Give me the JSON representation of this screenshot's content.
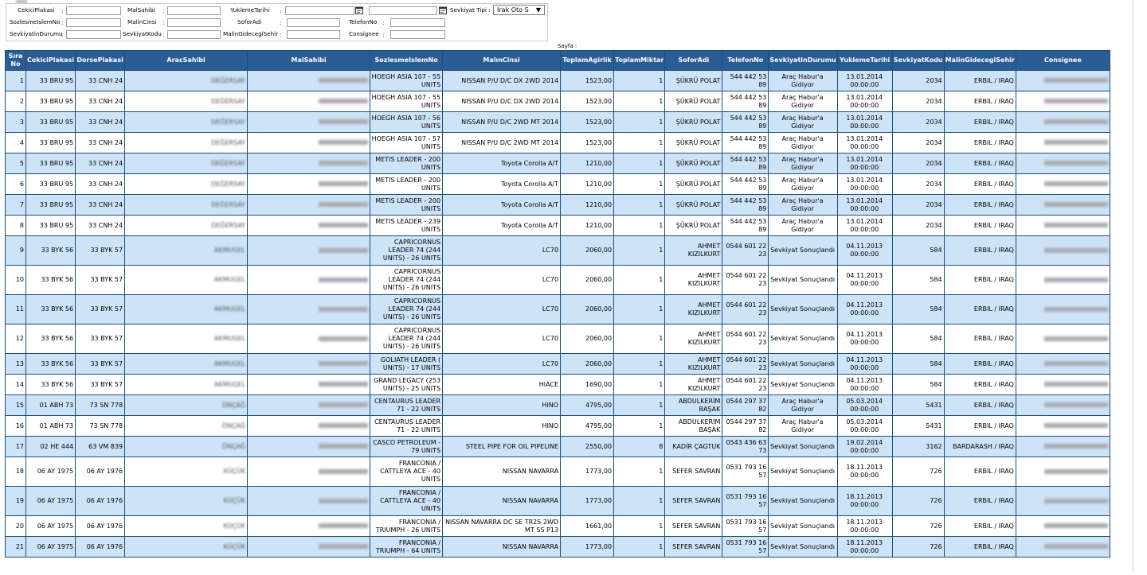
{
  "filters": {
    "cekici_label": "CekiciPlakasi",
    "malsahibi_label": "MalSahibi",
    "yukleme_label": "YuklemeTarihi",
    "sevkiyat_tipi_label": "Sevkiyat Tipi :",
    "sevkiyat_tipi_value": "Irak Oto S",
    "sozlesme_label": "SozlesmeIslemNo",
    "malincinsi_label": "MalinCinsi",
    "soforadi_label": "SoforAdi",
    "telefon_label": "TelefonNo",
    "sevkiyat_durumu_label": "SevkiyatinDurumu",
    "sevkiyat_kodu_label": "SevkiyatKodu",
    "malin_gidecegi_label": "MalinGidecegiSehir",
    "consignee_label": "Consignee",
    "colon": ":"
  },
  "sayfa_label": "Sayfa :",
  "table": {
    "headers": [
      "Sıra No",
      "CekiciPlakasi",
      "DorsePlakasi",
      "AracSahibi",
      "MalSahibi",
      "SozlesmeIslemNo",
      "MalınCinsi",
      "ToplamAgirlik",
      "ToplamMiktar",
      "SoforAdi",
      "TelefonNo",
      "SevkiyatinDurumu",
      "YuklemeTarihi",
      "SevkiyatKodu",
      "MalinGidecegiSehir",
      "Consignee"
    ],
    "rows": [
      {
        "no": "1",
        "cekici": "33 BRU 95",
        "dorse": "33 CNH 24",
        "arac": "DEĞERSAY",
        "sozlesme": "HOEGH ASIA 107 - 55 UNITS",
        "malin": "NISSAN P/U D/C DX 2WD 2014",
        "agirlik": "1523,00",
        "miktar": "1",
        "sofor": "ŞÜKRÜ POLAT",
        "tel": "544 442 53 89",
        "durum": "Araç Habur'a Gidiyor",
        "tarih": "13.01.2014 00:00:00",
        "kod": "2034",
        "sehir": "ERBIL / IRAQ"
      },
      {
        "no": "2",
        "cekici": "33 BRU 95",
        "dorse": "33 CNH 24",
        "arac": "DEĞERSAY",
        "sozlesme": "HOEGH ASIA 107 - 55 UNITS",
        "malin": "NISSAN P/U D/C DX 2WD 2014",
        "agirlik": "1523,00",
        "miktar": "1",
        "sofor": "ŞÜKRÜ POLAT",
        "tel": "544 442 53 89",
        "durum": "Araç Habur'a Gidiyor",
        "tarih": "13.01.2014 00:00:00",
        "kod": "2034",
        "sehir": "ERBIL / IRAQ"
      },
      {
        "no": "3",
        "cekici": "33 BRU 95",
        "dorse": "33 CNH 24",
        "arac": "DEĞERSAY",
        "sozlesme": "HOEGH ASIA 107 - 56 UNITS",
        "malin": "NISSAN P/U D/C 2WD MT 2014",
        "agirlik": "1523,00",
        "miktar": "1",
        "sofor": "ŞÜKRÜ POLAT",
        "tel": "544 442 53 89",
        "durum": "Araç Habur'a Gidiyor",
        "tarih": "13.01.2014 00:00:00",
        "kod": "2034",
        "sehir": "ERBIL / IRAQ"
      },
      {
        "no": "4",
        "cekici": "33 BRU 95",
        "dorse": "33 CNH 24",
        "arac": "DEĞERSAY",
        "sozlesme": "HOEGH ASIA 107 - 57 UNITS",
        "malin": "NISSAN P/U D/C 2WD MT 2014",
        "agirlik": "1523,00",
        "miktar": "1",
        "sofor": "ŞÜKRÜ POLAT",
        "tel": "544 442 53 89",
        "durum": "Araç Habur'a Gidiyor",
        "tarih": "13.01.2014 00:00:00",
        "kod": "2034",
        "sehir": "ERBIL / IRAQ"
      },
      {
        "no": "5",
        "cekici": "33 BRU 95",
        "dorse": "33 CNH 24",
        "arac": "DEĞERSAY",
        "sozlesme": "METIS LEADER - 200 UNITS",
        "malin": "Toyota Corolla A/T",
        "agirlik": "1210,00",
        "miktar": "1",
        "sofor": "ŞÜKRÜ POLAT",
        "tel": "544 442 53 89",
        "durum": "Araç Habur'a Gidiyor",
        "tarih": "13.01.2014 00:00:00",
        "kod": "2034",
        "sehir": "ERBIL / IRAQ"
      },
      {
        "no": "6",
        "cekici": "33 BRU 95",
        "dorse": "33 CNH 24",
        "arac": "DEĞERSAY",
        "sozlesme": "METIS LEADER - 200 UNITS",
        "malin": "Toyota Corolla A/T",
        "agirlik": "1210,00",
        "miktar": "1",
        "sofor": "ŞÜKRÜ POLAT",
        "tel": "544 442 53 89",
        "durum": "Araç Habur'a Gidiyor",
        "tarih": "13.01.2014 00:00:00",
        "kod": "2034",
        "sehir": "ERBIL / IRAQ"
      },
      {
        "no": "7",
        "cekici": "33 BRU 95",
        "dorse": "33 CNH 24",
        "arac": "DEĞERSAY",
        "sozlesme": "METIS LEADER - 200 UNITS",
        "malin": "Toyota Corolla A/T",
        "agirlik": "1210,00",
        "miktar": "1",
        "sofor": "ŞÜKRÜ POLAT",
        "tel": "544 442 53 89",
        "durum": "Araç Habur'a Gidiyor",
        "tarih": "13.01.2014 00:00:00",
        "kod": "2034",
        "sehir": "ERBIL / IRAQ"
      },
      {
        "no": "8",
        "cekici": "33 BRU 95",
        "dorse": "33 CNH 24",
        "arac": "DEĞERSAY",
        "sozlesme": "METIS LEADER - 239 UNITS",
        "malin": "Toyota Corolla A/T",
        "agirlik": "1210,00",
        "miktar": "1",
        "sofor": "ŞÜKRÜ POLAT",
        "tel": "544 442 53 89",
        "durum": "Araç Habur'a Gidiyor",
        "tarih": "13.01.2014 00:00:00",
        "kod": "2034",
        "sehir": "ERBIL / IRAQ"
      },
      {
        "no": "9",
        "cekici": "33 BYK 56",
        "dorse": "33 BYK 57",
        "arac": "AKMUGEL",
        "sozlesme": "CAPRICORNUS LEADER 74 (244 UNITS) - 26 UNITS",
        "malin": "LC70",
        "agirlik": "2060,00",
        "miktar": "1",
        "sofor": "AHMET KIZILKURT",
        "tel": "0544 601 22 23",
        "durum": "Sevkiyat Sonuçlandı",
        "tarih": "04.11.2013 00:00:00",
        "kod": "584",
        "sehir": "ERBIL / IRAQ"
      },
      {
        "no": "10",
        "cekici": "33 BYK 56",
        "dorse": "33 BYK 57",
        "arac": "AKMUGEL",
        "sozlesme": "CAPRICORNUS LEADER 74 (244 UNITS) - 26 UNITS",
        "malin": "LC70",
        "agirlik": "2060,00",
        "miktar": "1",
        "sofor": "AHMET KIZILKURT",
        "tel": "0544 601 22 23",
        "durum": "Sevkiyat Sonuçlandı",
        "tarih": "04.11.2013 00:00:00",
        "kod": "584",
        "sehir": "ERBIL / IRAQ"
      },
      {
        "no": "11",
        "cekici": "33 BYK 56",
        "dorse": "33 BYK 57",
        "arac": "AKMUGEL",
        "sozlesme": "CAPRICORNUS LEADER 74 (244 UNITS) - 26 UNITS",
        "malin": "LC70",
        "agirlik": "2060,00",
        "miktar": "1",
        "sofor": "AHMET KIZILKURT",
        "tel": "0544 601 22 23",
        "durum": "Sevkiyat Sonuçlandı",
        "tarih": "04.11.2013 00:00:00",
        "kod": "584",
        "sehir": "ERBIL / IRAQ"
      },
      {
        "no": "12",
        "cekici": "33 BYK 56",
        "dorse": "33 BYK 57",
        "arac": "AKMUGEL",
        "sozlesme": "CAPRICORNUS LEADER 74 (244 UNITS) - 26 UNITS",
        "malin": "LC70",
        "agirlik": "2060,00",
        "miktar": "1",
        "sofor": "AHMET KIZILKURT",
        "tel": "0544 601 22 23",
        "durum": "Sevkiyat Sonuçlandı",
        "tarih": "04.11.2013 00:00:00",
        "kod": "584",
        "sehir": "ERBIL / IRAQ"
      },
      {
        "no": "13",
        "cekici": "33 BYK 56",
        "dorse": "33 BYK 57",
        "arac": "AKMUGEL",
        "sozlesme": "GOLIATH LEADER ( UNITS) - 17 UNITS",
        "malin": "LC70",
        "agirlik": "2060,00",
        "miktar": "1",
        "sofor": "AHMET KIZILKURT",
        "tel": "0544 601 22 23",
        "durum": "Sevkiyat Sonuçlandı",
        "tarih": "04.11.2013 00:00:00",
        "kod": "584",
        "sehir": "ERBIL / IRAQ"
      },
      {
        "no": "14",
        "cekici": "33 BYK 56",
        "dorse": "33 BYK 57",
        "arac": "AKMUGEL",
        "sozlesme": "GRAND LEGACY (253 UNITS) - 25 UNITS",
        "malin": "HIACE",
        "agirlik": "1690,00",
        "miktar": "1",
        "sofor": "AHMET KIZILKURT",
        "tel": "0544 601 22 23",
        "durum": "Sevkiyat Sonuçlandı",
        "tarih": "04.11.2013 00:00:00",
        "kod": "584",
        "sehir": "ERBIL / IRAQ"
      },
      {
        "no": "15",
        "cekici": "01 ABH 73",
        "dorse": "73 SN 778",
        "arac": "ÖNÇAĞ",
        "sozlesme": "CENTAURUS LEADER 71 - 22 UNITS",
        "malin": "HINO",
        "agirlik": "4795,00",
        "miktar": "1",
        "sofor": "ABDULKERİM BAŞAK",
        "tel": "0544 297 37 82",
        "durum": "Araç Habur'a Gidiyor",
        "tarih": "05.03.2014 00:00:00",
        "kod": "5431",
        "sehir": "ERBIL / IRAQ"
      },
      {
        "no": "16",
        "cekici": "01 ABH 73",
        "dorse": "73 SN 778",
        "arac": "ÖNÇAĞ",
        "sozlesme": "CENTAURUS LEADER 71 - 22 UNITS",
        "malin": "HINO",
        "agirlik": "4795,00",
        "miktar": "1",
        "sofor": "ABDULKERİM BAŞAK",
        "tel": "0544 297 37 82",
        "durum": "Araç Habur'a Gidiyor",
        "tarih": "05.03.2014 00:00:00",
        "kod": "5431",
        "sehir": "ERBIL / IRAQ"
      },
      {
        "no": "17",
        "cekici": "02 HE 444",
        "dorse": "63 VM 839",
        "arac": "ÖNÇAĞ",
        "sozlesme": "CASCO PETROLEUM - 79 UNITS",
        "malin": "STEEL PIPE FOR OIL PIPELINE",
        "agirlik": "2550,00",
        "miktar": "8",
        "sofor": "KADİR ÇAGTUK",
        "tel": "0543 436 63 73",
        "durum": "Sevkiyat Sonuçlandı",
        "tarih": "19.02.2014 00:00:00",
        "kod": "3162",
        "sehir": "BARDARASH / IRAQ"
      },
      {
        "no": "18",
        "cekici": "06 AY 1975",
        "dorse": "06 AY 1976",
        "arac": "KÜÇÜK",
        "sozlesme": "FRANCONIA / CATTLEYA ACE - 40 UNITS",
        "malin": "NISSAN NAVARRA",
        "agirlik": "1773,00",
        "miktar": "1",
        "sofor": "SEFER SAVRAN",
        "tel": "0531 793 16 57",
        "durum": "Sevkiyat Sonuçlandı",
        "tarih": "18.11.2013 00:00:00",
        "kod": "726",
        "sehir": "ERBIL / IRAQ"
      },
      {
        "no": "19",
        "cekici": "06 AY 1975",
        "dorse": "06 AY 1976",
        "arac": "KÜÇÜK",
        "sozlesme": "FRANCONIA / CATTLEYA ACE - 40 UNITS",
        "malin": "NISSAN NAVARRA",
        "agirlik": "1773,00",
        "miktar": "1",
        "sofor": "SEFER SAVRAN",
        "tel": "0531 793 16 57",
        "durum": "Sevkiyat Sonuçlandı",
        "tarih": "18.11.2013 00:00:00",
        "kod": "726",
        "sehir": "ERBIL / IRAQ"
      },
      {
        "no": "20",
        "cekici": "06 AY 1975",
        "dorse": "06 AY 1976",
        "arac": "KÜÇÜK",
        "sozlesme": "FRANCONIA / TRIUMPH - 26 UNITS",
        "malin": "NISSAN NAVARRA DC SE TR25 2WD MT SS P13",
        "agirlik": "1661,00",
        "miktar": "1",
        "sofor": "SEFER SAVRAN",
        "tel": "0531 793 16 57",
        "durum": "Sevkiyat Sonuçlandı",
        "tarih": "18.11.2013 00:00:00",
        "kod": "726",
        "sehir": "ERBIL / IRAQ"
      },
      {
        "no": "21",
        "cekici": "06 AY 1975",
        "dorse": "06 AY 1976",
        "arac": "KÜÇÜK",
        "sozlesme": "FRANCONIA / TRIUMPH - 64 UNITS",
        "malin": "NISSAN NAVARRA",
        "agirlik": "1773,00",
        "miktar": "1",
        "sofor": "SEFER SAVRAN",
        "tel": "0531 793 16 57",
        "durum": "Sevkiyat Sonuçlandı",
        "tarih": "18.11.2013 00:00:00",
        "kod": "726",
        "sehir": "ERBIL / IRAQ"
      }
    ]
  }
}
